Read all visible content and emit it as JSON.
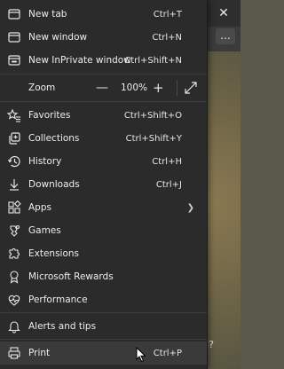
{
  "menu": {
    "items": [
      {
        "label": "New tab",
        "shortcut": "Ctrl+T",
        "icon": "new-tab-icon"
      },
      {
        "label": "New window",
        "shortcut": "Ctrl+N",
        "icon": "new-window-icon"
      },
      {
        "label": "New InPrivate window",
        "shortcut": "Ctrl+Shift+N",
        "icon": "inprivate-icon"
      }
    ],
    "zoom": {
      "label": "Zoom",
      "minus": "—",
      "value": "100%",
      "plus": "+"
    },
    "items2": [
      {
        "label": "Favorites",
        "shortcut": "Ctrl+Shift+O",
        "icon": "favorites-icon"
      },
      {
        "label": "Collections",
        "shortcut": "Ctrl+Shift+Y",
        "icon": "collections-icon"
      },
      {
        "label": "History",
        "shortcut": "Ctrl+H",
        "icon": "history-icon"
      },
      {
        "label": "Downloads",
        "shortcut": "Ctrl+J",
        "icon": "downloads-icon"
      },
      {
        "label": "Apps",
        "shortcut": "",
        "icon": "apps-icon"
      },
      {
        "label": "Games",
        "shortcut": "",
        "icon": "games-icon"
      },
      {
        "label": "Extensions",
        "shortcut": "",
        "icon": "extensions-icon"
      },
      {
        "label": "Microsoft Rewards",
        "shortcut": "",
        "icon": "rewards-icon"
      },
      {
        "label": "Performance",
        "shortcut": "",
        "icon": "performance-icon"
      }
    ],
    "alerts": {
      "label": "Alerts and tips",
      "icon": "bell-icon"
    },
    "print": {
      "label": "Print",
      "shortcut": "Ctrl+P",
      "icon": "print-icon"
    }
  },
  "background": {
    "close_glyph": "✕",
    "more_glyph": "...",
    "partial_text": "d?"
  }
}
